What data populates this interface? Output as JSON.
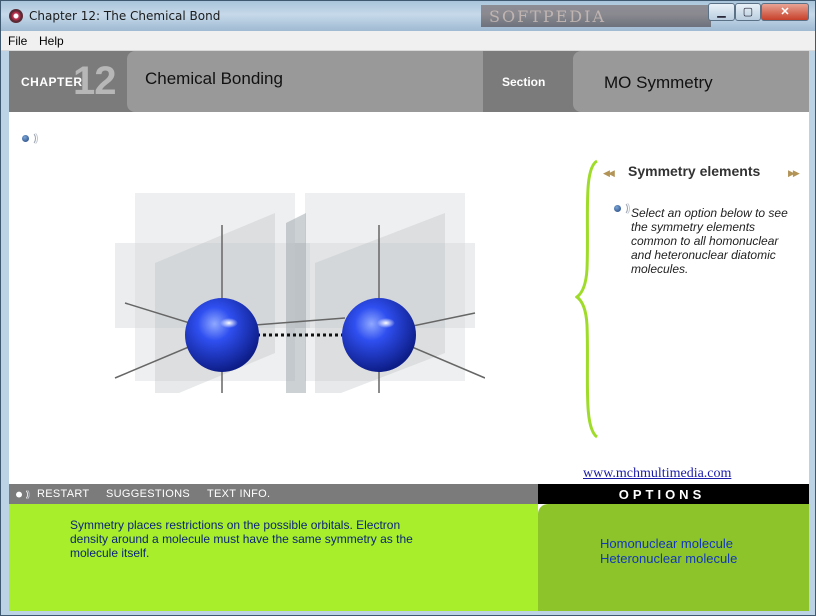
{
  "window": {
    "title": "Chapter 12: The Chemical Bond",
    "watermark": "SOFTPEDIA",
    "buttons": {
      "minimize": "▁",
      "maximize": "▢",
      "close": "✕"
    }
  },
  "menu": {
    "items": [
      "File",
      "Help"
    ]
  },
  "header": {
    "chapter_label": "CHAPTER",
    "chapter_number": "12",
    "title": "Chemical Bonding",
    "section_label": "Section",
    "section_title": "MO Symmetry"
  },
  "symmetry_panel": {
    "title": "Symmetry elements",
    "prev_icon": "◀◀",
    "next_icon": "▶▶",
    "text": "Select an option below to see the symmetry elements common to all homonuclear and heteronuclear diatomic molecules."
  },
  "weblink": "www.mchmultimedia.com",
  "controls": {
    "restart": "RESTART",
    "suggestions": "SUGGESTIONS",
    "text_info": "TEXT INFO."
  },
  "options": {
    "header": "OPTIONS",
    "items": [
      "Homonuclear molecule",
      "Heteronuclear molecule"
    ]
  },
  "info_text": "Symmetry places restrictions on the possible orbitals. Electron density around a molecule must have the same symmetry as the molecule itself.",
  "icons": {
    "app": "app-icon",
    "speaker": "speaker-icon"
  },
  "colors": {
    "header_dark": "#7b7b7b",
    "header_light": "#999999",
    "info_green": "#a8ee2a",
    "options_green": "#8cc42a",
    "brace_green": "#9fdc2a",
    "atom_blue": "#1f3fd0"
  }
}
